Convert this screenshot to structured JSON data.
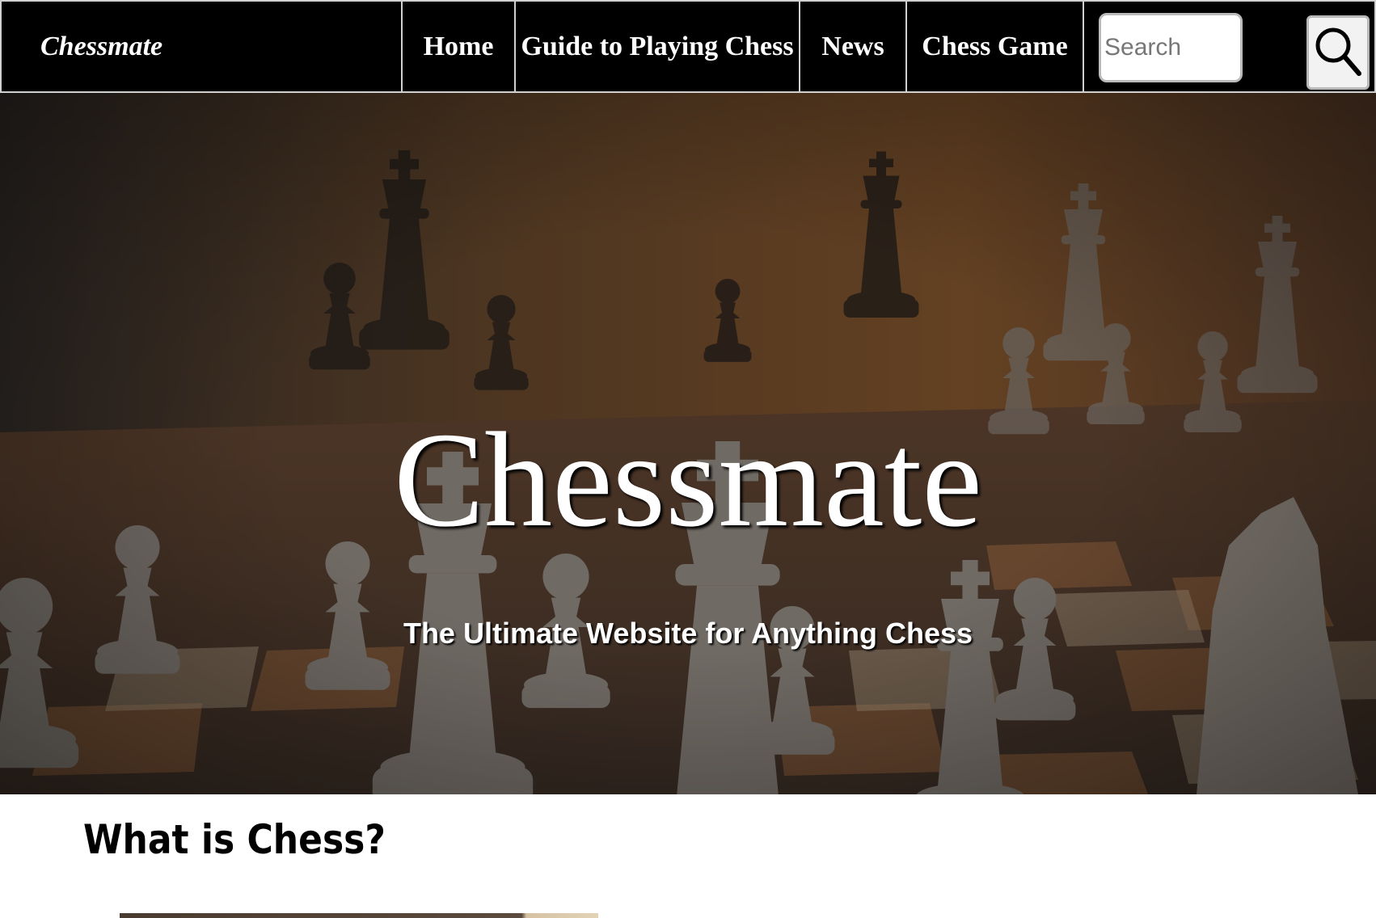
{
  "navbar": {
    "brand": "Chessmate",
    "items": [
      {
        "label": "Home"
      },
      {
        "label": "Guide to Playing Chess"
      },
      {
        "label": "News"
      },
      {
        "label": "Chess Game"
      }
    ],
    "search": {
      "placeholder": "Search",
      "button_icon": "search-icon"
    }
  },
  "hero": {
    "title": "Chessmate",
    "subtitle": "The Ultimate Website for Anything Chess"
  },
  "main": {
    "section_heading": "What is Chess?"
  },
  "colors": {
    "navbar_bg": "#000000",
    "nav_divider": "#d0d0d0",
    "text_on_dark": "#ffffff"
  }
}
